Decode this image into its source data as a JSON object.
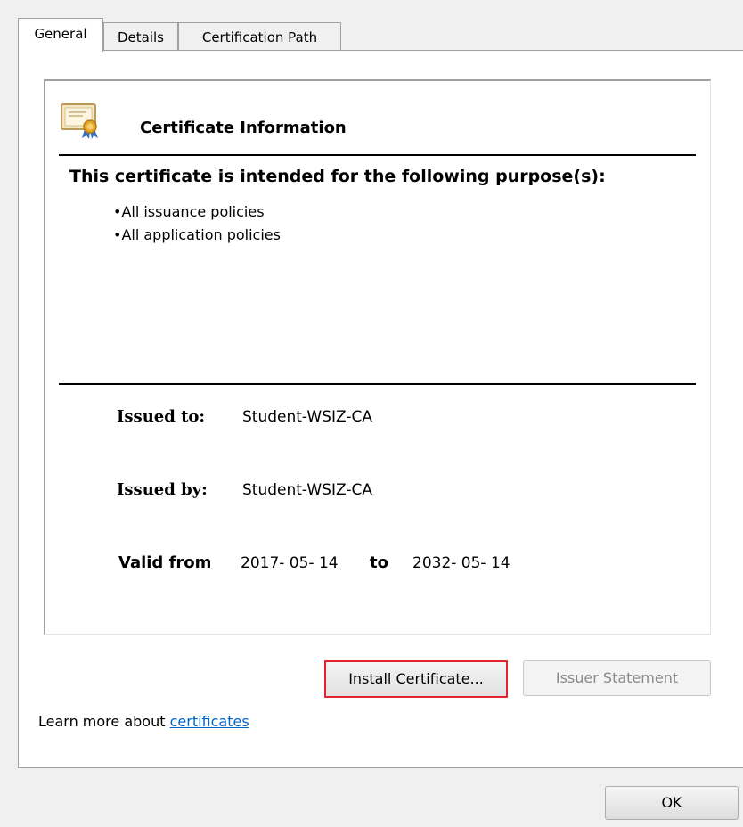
{
  "tabs": [
    {
      "label": "General",
      "active": true
    },
    {
      "label": "Details",
      "active": false
    },
    {
      "label": "Certification Path",
      "active": false
    }
  ],
  "certificate": {
    "icon": "certificate-icon",
    "title": "Certificate Information",
    "purpose_heading": "This certificate is intended for the following purpose(s):",
    "purposes": [
      "All issuance policies",
      "All application policies"
    ],
    "issued_to_label": "Issued to:",
    "issued_to": "Student-WSIZ-CA",
    "issued_by_label": "Issued by:",
    "issued_by": "Student-WSIZ-CA",
    "valid_from_label": "Valid from",
    "valid_from": "2017- 05- 14",
    "to_label": "to",
    "valid_to": "2032- 05- 14"
  },
  "buttons": {
    "install": "Install Certificate...",
    "issuer_statement": "Issuer Statement",
    "ok": "OK"
  },
  "learn_more": {
    "prefix": "Learn more about ",
    "link": "certificates"
  },
  "colors": {
    "highlight": "#e3232c",
    "link": "#0066cc"
  }
}
